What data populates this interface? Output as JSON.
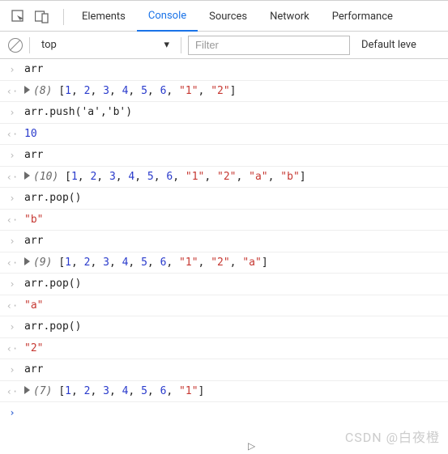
{
  "tabs": {
    "elements": "Elements",
    "console": "Console",
    "sources": "Sources",
    "network": "Network",
    "performance": "Performance"
  },
  "toolbar": {
    "context": "top",
    "filter_placeholder": "Filter",
    "levels": "Default leve"
  },
  "lines": {
    "l0_cmd": "arr",
    "l1_len": "(8)",
    "l2_cmd": "arr.push('a','b')",
    "l3_res": "10",
    "l4_cmd": "arr",
    "l5_len": "(10)",
    "l6_cmd": "arr.pop()",
    "l7_res": "\"b\"",
    "l8_cmd": "arr",
    "l9_len": "(9)",
    "l10_cmd": "arr.pop()",
    "l11_res": "\"a\"",
    "l12_cmd": "arr.pop()",
    "l13_res": "\"2\"",
    "l14_cmd": "arr",
    "l15_len": "(7)"
  },
  "chart_data": {
    "type": "table",
    "title": "Console array states",
    "rows": [
      {
        "expr": "arr",
        "length": 8,
        "values": [
          1,
          2,
          3,
          4,
          5,
          6,
          "1",
          "2"
        ]
      },
      {
        "expr": "arr.push('a','b')",
        "result": 10
      },
      {
        "expr": "arr",
        "length": 10,
        "values": [
          1,
          2,
          3,
          4,
          5,
          6,
          "1",
          "2",
          "a",
          "b"
        ]
      },
      {
        "expr": "arr.pop()",
        "result": "b"
      },
      {
        "expr": "arr",
        "length": 9,
        "values": [
          1,
          2,
          3,
          4,
          5,
          6,
          "1",
          "2",
          "a"
        ]
      },
      {
        "expr": "arr.pop()",
        "result": "a"
      },
      {
        "expr": "arr.pop()",
        "result": "2"
      },
      {
        "expr": "arr",
        "length": 7,
        "values": [
          1,
          2,
          3,
          4,
          5,
          6,
          "1"
        ]
      }
    ]
  },
  "arrays": {
    "a8": {
      "nums": [
        1,
        2,
        3,
        4,
        5,
        6
      ],
      "strs": [
        "\"1\"",
        "\"2\""
      ]
    },
    "a10": {
      "nums": [
        1,
        2,
        3,
        4,
        5,
        6
      ],
      "strs": [
        "\"1\"",
        "\"2\"",
        "\"a\"",
        "\"b\""
      ]
    },
    "a9": {
      "nums": [
        1,
        2,
        3,
        4,
        5,
        6
      ],
      "strs": [
        "\"1\"",
        "\"2\"",
        "\"a\""
      ]
    },
    "a7": {
      "nums": [
        1,
        2,
        3,
        4,
        5,
        6
      ],
      "strs": [
        "\"1\""
      ]
    }
  },
  "watermark": "CSDN @白夜橙"
}
